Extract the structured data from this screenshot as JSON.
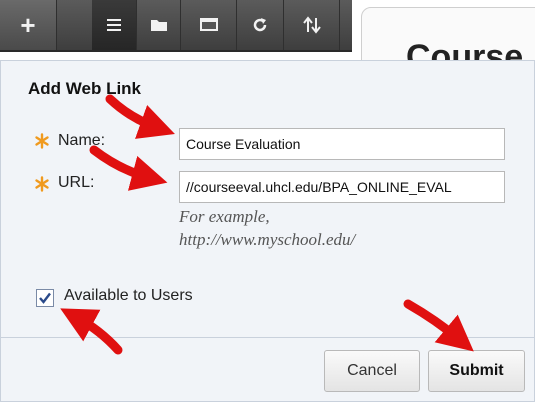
{
  "toolbar": {
    "add_glyph": "+",
    "icons": [
      "add-icon",
      "list-icon",
      "folder-icon",
      "window-icon",
      "refresh-icon",
      "sort-icon"
    ]
  },
  "title_tab": {
    "text": "Course"
  },
  "form": {
    "title": "Add Web Link",
    "name_label": "Name:",
    "name_value": "Course Evaluation",
    "url_label": "URL:",
    "url_value": "//courseeval.uhcl.edu/BPA_ONLINE_EVAL",
    "hint_line1": "For example,",
    "hint_line2": "http://www.myschool.edu/",
    "available_label": "Available to Users",
    "available_checked": true
  },
  "buttons": {
    "cancel": "Cancel",
    "submit": "Submit"
  },
  "colors": {
    "required_star": "#f09a1e",
    "arrow": "#e01010",
    "toolbar": "#4a4a4a"
  }
}
